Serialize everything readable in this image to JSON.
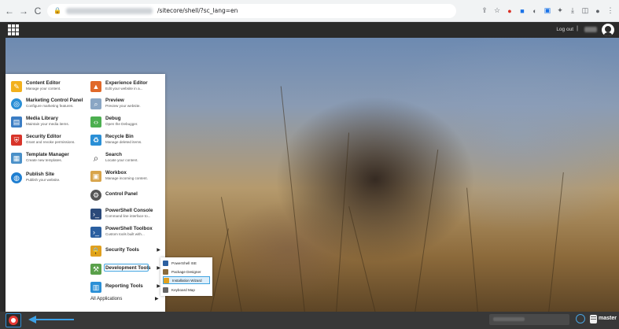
{
  "browser": {
    "url_path": "/sitecore/shell/?sc_lang=en"
  },
  "topbar": {
    "logout_label": "Log out",
    "separator": "|"
  },
  "menu": {
    "left": [
      {
        "title": "Content Editor",
        "subtitle": "Manage your content.",
        "icon": "pencil-icon",
        "color": "#f2b01e"
      },
      {
        "title": "Marketing Control Panel",
        "subtitle": "Configure marketing features.",
        "icon": "target-icon",
        "color": "#2a8fd6"
      },
      {
        "title": "Media Library",
        "subtitle": "Maintain your media items.",
        "icon": "media-icon",
        "color": "#3b7dc4"
      },
      {
        "title": "Security Editor",
        "subtitle": "Grant and revoke permissions.",
        "icon": "shield-icon",
        "color": "#d8342a"
      },
      {
        "title": "Template Manager",
        "subtitle": "Create new templates.",
        "icon": "template-icon",
        "color": "#4a90c8"
      },
      {
        "title": "Publish Site",
        "subtitle": "Publish your website.",
        "icon": "globe-icon",
        "color": "#1f7fd1"
      }
    ],
    "right": [
      {
        "title": "Experience Editor",
        "subtitle": "Edit your website in a...",
        "icon": "experience-icon",
        "color": "#e0692a"
      },
      {
        "title": "Preview",
        "subtitle": "Preview your website.",
        "icon": "preview-icon",
        "color": "#8aa6c4"
      },
      {
        "title": "Debug",
        "subtitle": "Open the Debugger.",
        "icon": "debug-icon",
        "color": "#4caf50"
      },
      {
        "title": "Recycle Bin",
        "subtitle": "Manage deleted items.",
        "icon": "recycle-icon",
        "color": "#2a8fd6"
      },
      {
        "title": "Search",
        "subtitle": "Locate your content.",
        "icon": "search-icon",
        "color": "#555555"
      },
      {
        "title": "Workbox",
        "subtitle": "Manage incoming content.",
        "icon": "workbox-icon",
        "color": "#d8a44a"
      },
      {
        "title": "Control Panel",
        "subtitle": "",
        "icon": "control-panel-icon",
        "color": "#555555"
      },
      {
        "title": "PowerShell Console",
        "subtitle": "Command line interface to...",
        "icon": "powershell-console-icon",
        "color": "#2b4a7a"
      },
      {
        "title": "PowerShell Toolbox",
        "subtitle": "Custom tools built with...",
        "icon": "powershell-toolbox-icon",
        "color": "#2b5fa0"
      },
      {
        "title": "Security Tools",
        "subtitle": "",
        "icon": "lock-icon",
        "color": "#e0a01e"
      },
      {
        "title": "Development Tools",
        "subtitle": "",
        "icon": "development-tools-icon",
        "color": "#5aa04a"
      },
      {
        "title": "Reporting Tools",
        "subtitle": "",
        "icon": "reporting-tools-icon",
        "color": "#2a8fd6"
      }
    ],
    "all_applications": "All Applications"
  },
  "submenu": {
    "items": [
      {
        "label": "PowerShell ISE",
        "color": "#2b5fa0"
      },
      {
        "label": "Package Designer",
        "color": "#8a6a3a"
      },
      {
        "label": "Installation Wizard",
        "color": "#e0a01e"
      },
      {
        "label": "Keyboard Map",
        "color": "#666666"
      }
    ]
  },
  "taskbar": {
    "database": "master"
  }
}
